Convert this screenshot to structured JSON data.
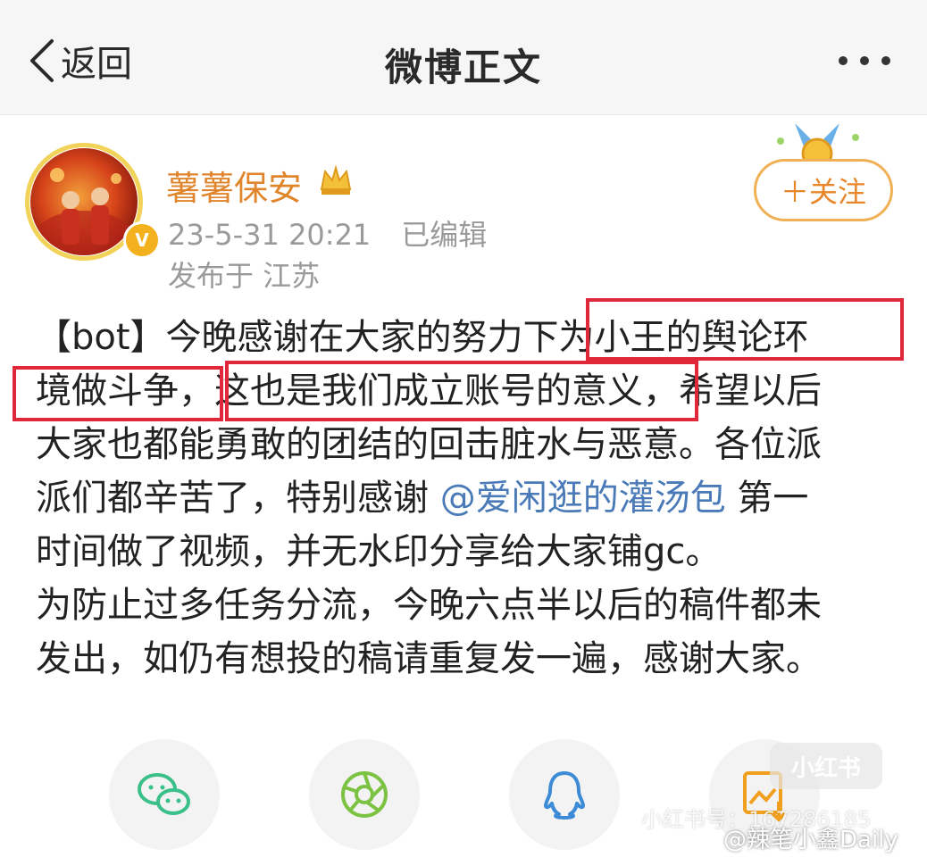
{
  "nav": {
    "back_label": "返回",
    "title": "微博正文",
    "more_icon": "more-dots-icon"
  },
  "author": {
    "name": "薯薯保安",
    "verified_badge": "V",
    "time": "23-5-31 20:21",
    "edited": "已编辑",
    "location": "发布于 江苏",
    "follow_label": "＋关注"
  },
  "post": {
    "line1_a": "【bot】今晚感谢在大家的努力下",
    "line1_b": "为小王的舆论环",
    "line2_a": "境做斗争，",
    "line2_b": "这也是我们成立账号的意义",
    "line2_c": "，希望以后",
    "line3": "大家也都能勇敢的团结的回击脏水与恶意。各位派",
    "line4_a": "派们都辛苦了，特别感谢 ",
    "mention": "@爱闲逛的灌汤包",
    "line4_b": " 第一",
    "line5": "时间做了视频，并无水印分享给大家铺gc。",
    "line6": "为防止过多任务分流，今晚六点半以后的稿件都未",
    "line7": "发出，如仍有想投的稿请重复发一遍，感谢大家。"
  },
  "share": {
    "items": [
      "wechat-icon",
      "moments-icon",
      "qq-icon",
      "save-image-icon"
    ]
  },
  "watermark": {
    "xhs_logo": "小红书",
    "xhs_id": "小红书号：167286185",
    "weibo": "@辣笔小鑫Daily"
  },
  "colors": {
    "username": "#e0852b",
    "mention": "#4a7ab8",
    "highlight_box": "#e0283a",
    "follow_border": "#f0b056"
  }
}
